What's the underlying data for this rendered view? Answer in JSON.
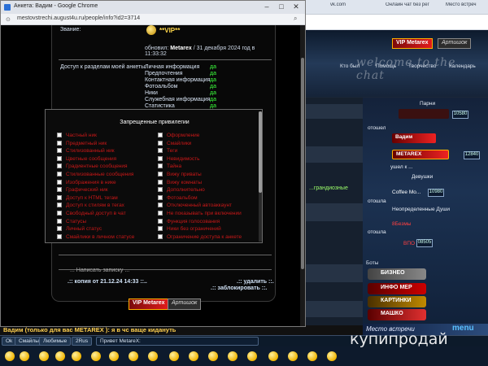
{
  "popup": {
    "title": "Анкета: Вадим - Google Chrome",
    "url": "mestovstrechi.august4u.ru/people/info?id2=3714",
    "controls": {
      "minimize": "–",
      "maximize": "□",
      "close": "✕"
    }
  },
  "profile": {
    "status_label": "Звание:",
    "status_value": "**VIP**",
    "updated_prefix": "обновил:",
    "updated_by": "Metarex",
    "updated_date": "/ 31 декабря 2024 год в 11:33:32",
    "access_label": "Доступ к разделам моей анкеты:",
    "access": [
      {
        "name": "Личная информация",
        "value": "да"
      },
      {
        "name": "Предпочтения",
        "value": "да"
      },
      {
        "name": "Контактная информация",
        "value": "да"
      },
      {
        "name": "Фотоальбом",
        "value": "да"
      },
      {
        "name": "Ники",
        "value": "да"
      },
      {
        "name": "Служебная информация",
        "value": "да"
      },
      {
        "name": "Статистика",
        "value": "да"
      }
    ],
    "write_note": "... Написать записку ...",
    "copy_line": ".:: копия от 21.12.24 14:33 ::..",
    "delete_line": ".:: удалить ::.",
    "block_line": ".:: заблокировать ::.",
    "vip_logo": "VIP Metarex",
    "dark_logo": "Артишок"
  },
  "privileges": {
    "title": "Запрещенные привилегии",
    "left": [
      "Частный ник",
      "Предметный ник",
      "Стилизованный ник",
      "Цветные сообщения",
      "Градиентные сообщения",
      "Стилизованные сообщения",
      "Изображения в нике",
      "Графический ник",
      "Доступ к HTML тегам",
      "Доступ к стилям в тегах",
      "Свободный доступ в чат",
      "Статусы",
      "Личный статус",
      "Смайлики в личном статусе"
    ],
    "right": [
      "Оформление",
      "Смайлики",
      "Теги",
      "Невидимость",
      "Тайна",
      "Вижу приваты",
      "Вижу комнаты",
      "Дополнительно",
      "Фотоальбом",
      "Отключенный автоаккаунт",
      "Не показывать при включении",
      "Функция голосования",
      "Ники без ограничений",
      "Ограничение доступа к анкете"
    ]
  },
  "background": {
    "tabs": [
      "Онлайн чат без рег",
      "vk.com",
      "Место встреч"
    ],
    "address": "",
    "banner_text": "welcome to the chat",
    "vip_logo": "VIP Metarex",
    "dark_logo": "Артишок",
    "nav": [
      "Кто был",
      "Помощь",
      "Творчество",
      "Календарь"
    ],
    "section_men": "Парни",
    "section_women": "Девушки",
    "nicks": [
      {
        "name": "Вадим",
        "badge": "",
        "note": "отошел"
      },
      {
        "name": "METAREX",
        "badge": "12840",
        "note": "ушел к ..."
      },
      {
        "name": "Coffee Mo...",
        "badge": "10980",
        "note": "отошла"
      },
      {
        "name": "Неопределенные Души",
        "badge": "",
        "note": ""
      },
      {
        "name": "8Безмы",
        "badge": "",
        "note": "отошла"
      },
      {
        "name": "ВПО",
        "badge": "08505",
        "note": ""
      }
    ],
    "bots_label": "Боты",
    "side_buttons": [
      "БИЗНЕО",
      "ИНФО МЕР",
      "КАРТИНКИ",
      "МАШКО"
    ],
    "green_text": "...грандиозные",
    "blue_text": "",
    "chat_line": "Вадим (только для вас METAREX ): я в чс ваще кидануть",
    "mesto": "Место встречи",
    "menu_logo": "menu",
    "bottom_buttons": [
      "Ok",
      "Смайлы",
      "Любимые",
      "2Rus",
      "Привет MetareX:"
    ],
    "watermark": "купипродай"
  },
  "colors": {
    "privilege_text": "#c81818",
    "yes": "#3cff3c",
    "vip_gold": "#ffd84a"
  }
}
